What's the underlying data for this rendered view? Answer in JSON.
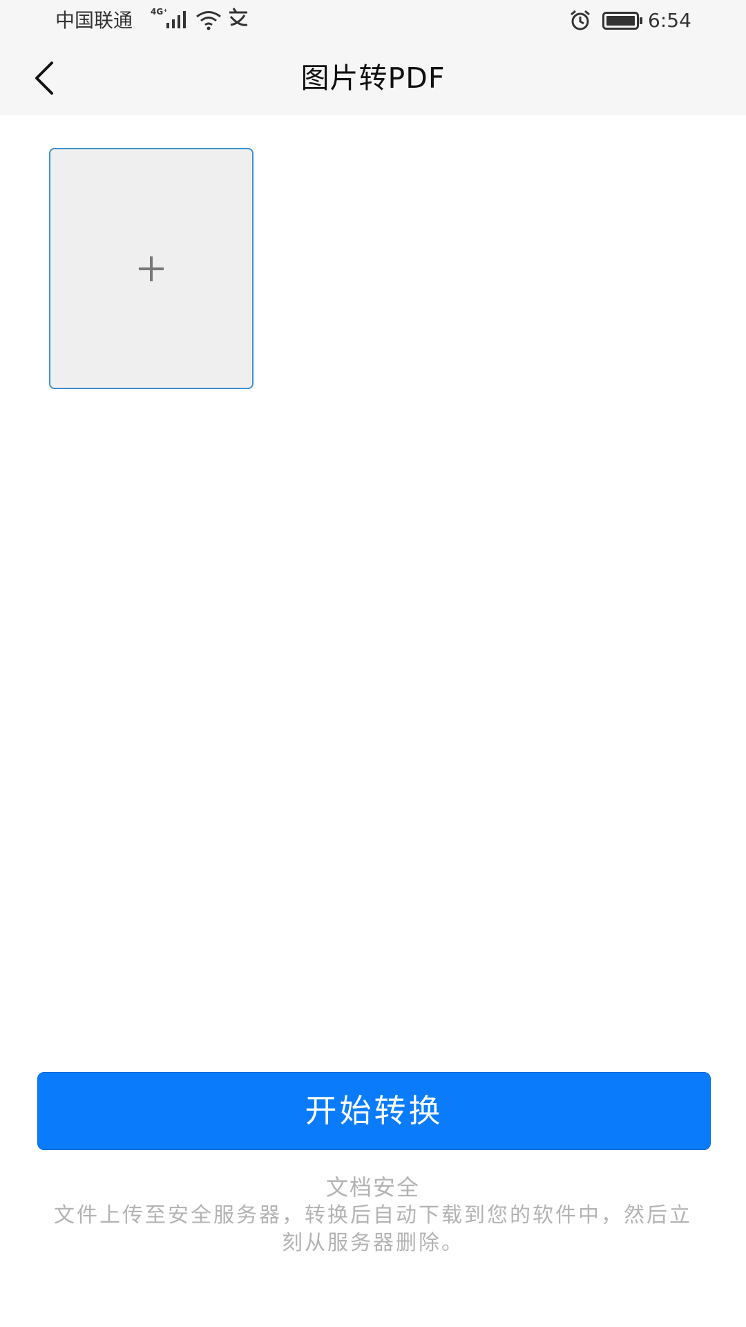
{
  "status_bar": {
    "carrier": "中国联通",
    "network_type": "4G⁺",
    "extra_icon_glyph": "⁠",
    "time": "6:54",
    "icons": [
      "signal-icon",
      "wifi-icon",
      "alarm-icon",
      "battery-icon"
    ]
  },
  "nav": {
    "back_icon": "chevron-left-icon",
    "title": "图片转PDF"
  },
  "add_tile": {
    "icon": "plus-icon",
    "border_color": "#3d8fd0",
    "background": "#efefef"
  },
  "actions": {
    "start_label": "开始转换",
    "button_color": "#0a7cfb"
  },
  "security": {
    "title": "文档安全",
    "description": "文件上传至安全服务器，转换后自动下载到您的软件中，然后立刻从服务器删除。"
  }
}
